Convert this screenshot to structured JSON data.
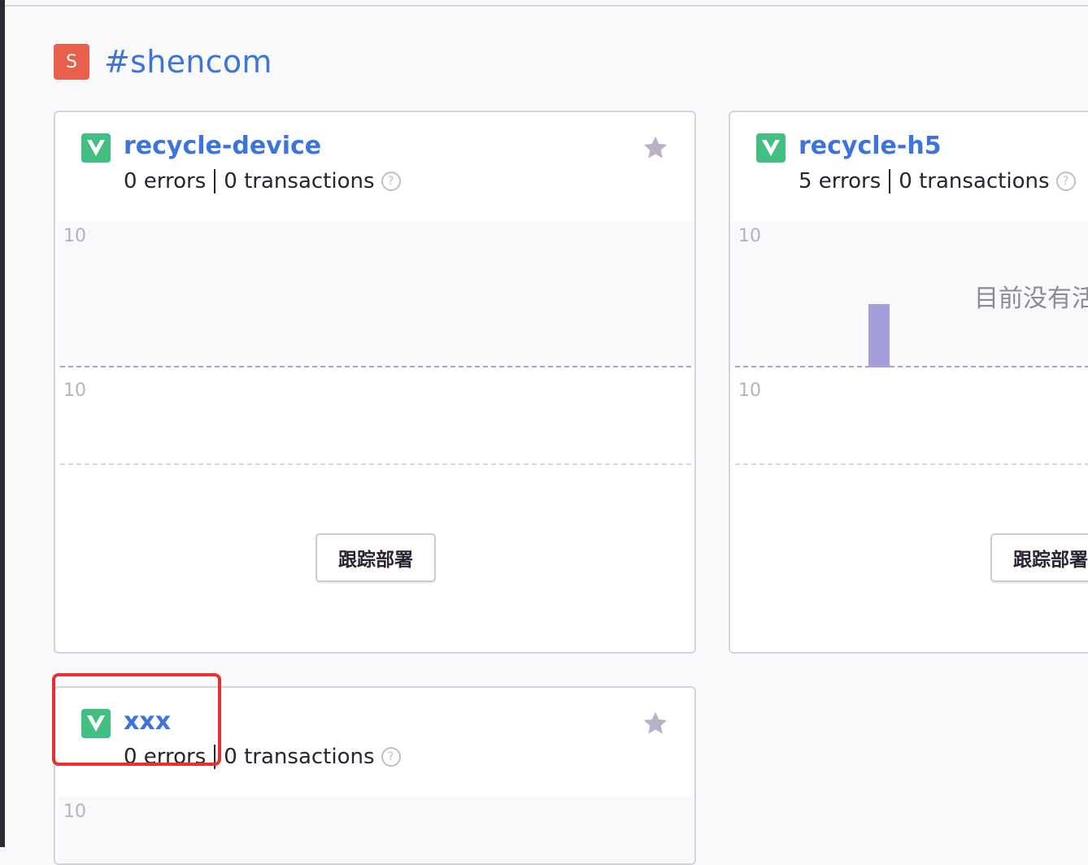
{
  "team": {
    "avatar_letter": "S",
    "name": "#shencom"
  },
  "projects": [
    {
      "name": "recycle-device",
      "errors": "0 errors",
      "transactions": "0 transactions",
      "help": "?",
      "y_axis_top": "10",
      "y_axis_bottom": "10",
      "deploy_button": "跟踪部署"
    },
    {
      "name": "recycle-h5",
      "errors": "5 errors",
      "transactions": "0 transactions",
      "help": "?",
      "y_axis_top": "10",
      "y_axis_bottom": "10",
      "no_activity_text": "目前没有活",
      "deploy_button": "跟踪部署"
    },
    {
      "name": "xxx",
      "errors": "0 errors",
      "transactions": "0 transactions",
      "help": "?",
      "y_axis_top": "10"
    }
  ],
  "colors": {
    "accent": "#3d74db",
    "platform": "#43bf84",
    "team_avatar": "#e8604c",
    "highlight": "#ea2f2f",
    "bar": "#a39fd9"
  },
  "icons": {
    "platform": "vue-icon",
    "favorite": "star-icon",
    "help": "question-circle-icon"
  }
}
